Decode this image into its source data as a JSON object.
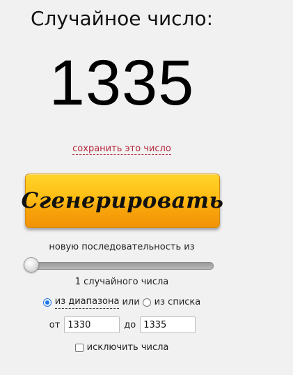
{
  "header": {
    "title": "Случайное число:"
  },
  "result": {
    "number": "1335",
    "save_link": "сохранить это число"
  },
  "generate": {
    "label": "Сгенерировать"
  },
  "sequence": {
    "label": "новую последовательность из",
    "slider_value": 1,
    "count_label": "1 случайного числа"
  },
  "mode": {
    "range_label": "из диапазона",
    "or_label": "или",
    "list_label": "из списка",
    "selected": "range"
  },
  "range": {
    "from_label": "от",
    "from_value": "1330",
    "to_label": "до",
    "to_value": "1335"
  },
  "exclude": {
    "label": "исключить числа",
    "checked": false
  },
  "colors": {
    "button_top": "#ffd52a",
    "button_bottom": "#f19308",
    "link": "#b5273b",
    "radio_accent": "#1a73e8",
    "background": "#f1f1f1"
  }
}
